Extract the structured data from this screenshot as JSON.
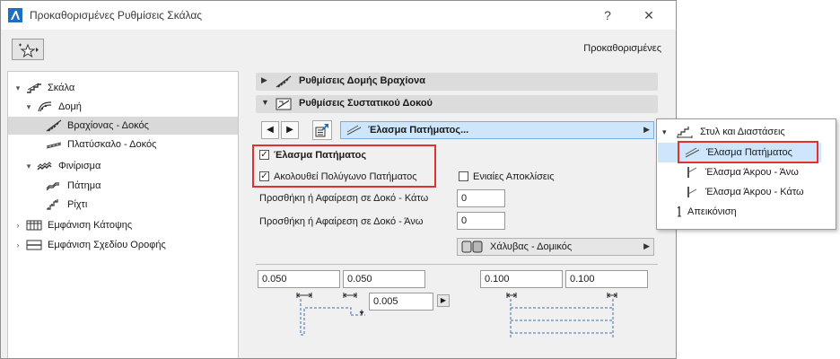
{
  "window": {
    "title": "Προκαθορισμένες Ρυθμίσεις Σκάλας",
    "help_label": "?",
    "close_label": "✕",
    "preset_label": "Προκαθορισμένες"
  },
  "tree": {
    "items": [
      {
        "label": "Σκάλα",
        "icon": "stair-icon"
      },
      {
        "label": "Δομή",
        "icon": "structure-icon"
      },
      {
        "label": "Βραχίονας - Δοκός",
        "icon": "flight-beam-icon"
      },
      {
        "label": "Πλατύσκαλο - Δοκός",
        "icon": "landing-beam-icon"
      },
      {
        "label": "Φινίρισμα",
        "icon": "finish-icon"
      },
      {
        "label": "Πάτημα",
        "icon": "tread-icon"
      },
      {
        "label": "Ρίχτι",
        "icon": "riser-icon"
      },
      {
        "label": "Εμφάνιση Κάτοψης",
        "icon": "floor-plan-icon"
      },
      {
        "label": "Εμφάνιση Σχεδίου Οροφής",
        "icon": "ceiling-plan-icon"
      }
    ]
  },
  "sections": {
    "flight_structure": "Ρυθμίσεις Δομής Βραχίονα",
    "beam_component": "Ρυθμίσεις Συστατικού Δοκού"
  },
  "component_selector": {
    "prev_label": "◀",
    "next_label": "▶",
    "current": "Έλασμα Πατήματος...",
    "expand_label": "▶"
  },
  "options": {
    "tread_plate": {
      "label": "Έλασμα Πατήματος",
      "checked": true
    },
    "follow_tread_polygon": {
      "label": "Ακολουθεί Πολύγωνο Πατήματος",
      "checked": true
    },
    "uniform_offsets": {
      "label": "Ενιαίες Αποκλίσεις",
      "checked": false
    }
  },
  "fields": {
    "bottom_offset": {
      "label": "Προσθήκη ή Αφαίρεση σε Δοκό - Κάτω",
      "value": "0"
    },
    "top_offset": {
      "label": "Προσθήκη ή Αφαίρεση σε Δοκό - Άνω",
      "value": "0"
    }
  },
  "material": {
    "label": "Χάλυβας - Δομικός",
    "expand_label": "▶"
  },
  "dimensions": {
    "left_1": "0.050",
    "left_2": "0.050",
    "left_3": "0.005",
    "right_1": "0.100",
    "right_2": "0.100",
    "stepper_label": "▶"
  },
  "popup": {
    "items": [
      {
        "label": "Στυλ και Διαστάσεις",
        "icon": "style-dimensions-icon"
      },
      {
        "label": "Έλασμα Πατήματος",
        "icon": "tread-plate-icon"
      },
      {
        "label": "Έλασμα Άκρου - Άνω",
        "icon": "end-plate-top-icon"
      },
      {
        "label": "Έλασμα Άκρου - Κάτω",
        "icon": "end-plate-bottom-icon"
      },
      {
        "label": "Απεικόνιση",
        "icon": "representation-icon"
      }
    ]
  },
  "colors": {
    "highlight": "#e0312f",
    "selection_blue": "#cde6fb",
    "tree_selection": "#d9d9d9"
  }
}
